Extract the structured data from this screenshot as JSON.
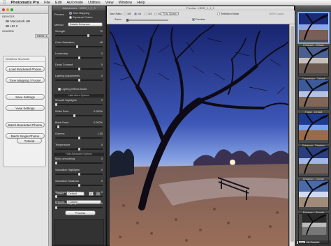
{
  "menubar": {
    "app": "Photomatix Pro",
    "items": [
      "File",
      "Edit",
      "Automate",
      "Utilities",
      "View",
      "Window",
      "Help"
    ]
  },
  "sidebar": {
    "devices_label": "DEVICES",
    "devices": [
      "Macintosh HD",
      "HD 2"
    ],
    "shared_label": "SHARED",
    "shared_tab": "HDR2_1_2_3"
  },
  "workflow": {
    "title": "Workflow Shortcuts",
    "buttons": [
      "Load Bracketed Photos",
      "Tone Mapping / Fusion",
      "Save Settings",
      "View Settings",
      "Batch Bracketed Photos",
      "Batch Single Photos"
    ],
    "tutorial": "Tutorial"
  },
  "adjustments": {
    "window_title": "Adjustments - HDR2_1_2_3",
    "process_label": "Process",
    "process_options": [
      "Tone Mapping",
      "Exposure Fusion"
    ],
    "method_label": "Method",
    "method_value": "Details Enhancer",
    "sliders": [
      {
        "label": "Strength",
        "value": "70",
        "pos": 0.7
      },
      {
        "label": "Color Saturation",
        "value": "46",
        "pos": 0.46
      },
      {
        "label": "Luminosity",
        "value": "0",
        "pos": 0.5
      },
      {
        "label": "Detail Contrast",
        "value": "0",
        "pos": 0.5
      },
      {
        "label": "Lighting Adjustments",
        "value": "0",
        "pos": 0.5
      }
    ],
    "lighting_effects_mode": "Lighting Effects Mode",
    "more_options_label": "Hide More Options",
    "more_sliders": [
      {
        "label": "Smooth Highlights",
        "value": "0",
        "pos": 0.0
      },
      {
        "label": "White Point",
        "value": "0.250%",
        "pos": 0.4
      },
      {
        "label": "Black Point",
        "value": "0.000%",
        "pos": 0.05
      },
      {
        "label": "Gamma",
        "value": "1.00",
        "pos": 0.5
      },
      {
        "label": "Temperature",
        "value": "0",
        "pos": 0.5
      }
    ],
    "advanced_label": "Hide Advanced Options",
    "advanced_sliders": [
      {
        "label": "Micro-smoothing",
        "value": "0",
        "pos": 0.0
      },
      {
        "label": "Saturation Highlights",
        "value": "0",
        "pos": 0.5
      },
      {
        "label": "Saturation Shadows",
        "value": "0",
        "pos": 0.5
      },
      {
        "label": "Shadows Smoothness",
        "value": "0",
        "pos": 0.0
      },
      {
        "label": "Shadows Clipping",
        "value": "0",
        "pos": 0.0
      }
    ],
    "reset_label": "Reset:",
    "reset_value": "Default",
    "presets_label": "Presets:",
    "presets_value": "Custom",
    "process_button": "Process"
  },
  "preview": {
    "window_title": "Preview - HDR2_1_2_3",
    "size_ratio_label": "Size Ratio",
    "ratios": [
      "1/8",
      "1/4",
      "1/3",
      "1/2"
    ],
    "fit_button": "Fit to Screen",
    "zoom_label": "Zoom",
    "selection_mode": "Selection Mode",
    "preview_checkbox": "Preview",
    "loupe_label": "100% Loupe"
  },
  "presets_panel": {
    "items": [
      "Enhancer - Default",
      "Compressor - Default",
      "Fusion - Default",
      "Enhancer - Painterly",
      "Enhancer - Grunge",
      "Enhancer - Smooth",
      ""
    ],
    "bar_tabs": [
      "Builtin",
      "My Presets"
    ]
  },
  "colors": {
    "panel_dark": "#3b3b3b",
    "sky_top": "#1c2a7a",
    "sky_bottom": "#9fb6e8",
    "ground": "#8a6a58"
  }
}
